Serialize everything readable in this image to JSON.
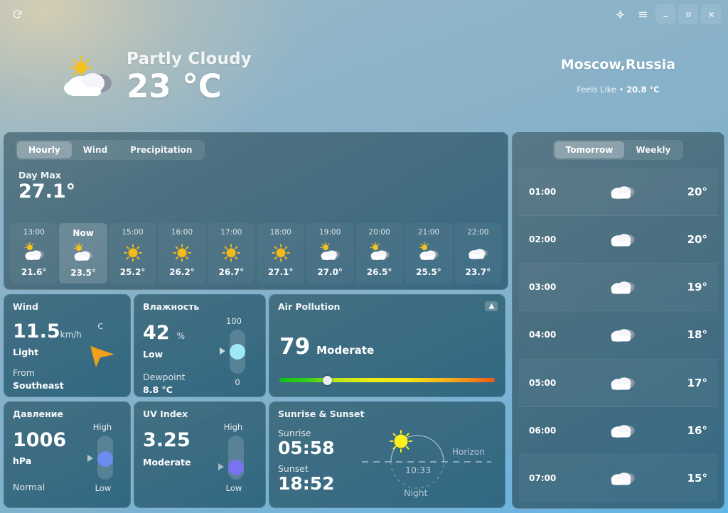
{
  "titlebar": {
    "refresh_icon": "refresh-icon",
    "location_icon": "location-target-icon",
    "menu_icon": "hamburger-menu-icon",
    "minimize_icon": "minimize-icon",
    "maximize_icon": "maximize-icon",
    "close_icon": "close-icon"
  },
  "hero": {
    "condition": "Partly Cloudy",
    "temperature": "23 °C",
    "icon": "partly-cloudy-icon",
    "city": "Moscow,Russia",
    "feels_like_label": "Feels Like •",
    "feels_like_value": "20.8 °C"
  },
  "forecast_tabs": [
    {
      "label": "Hourly",
      "active": true
    },
    {
      "label": "Wind",
      "active": false
    },
    {
      "label": "Precipitation",
      "active": false
    }
  ],
  "day_max": {
    "label": "Day Max",
    "value": "27.1°"
  },
  "hourly": [
    {
      "time": "13:00",
      "temp": "21.6°",
      "icon": "partly-cloudy",
      "now": false
    },
    {
      "time": "Now",
      "temp": "23.5°",
      "icon": "partly-cloudy",
      "now": true
    },
    {
      "time": "15:00",
      "temp": "25.2°",
      "icon": "sunny",
      "now": false
    },
    {
      "time": "16:00",
      "temp": "26.2°",
      "icon": "sunny",
      "now": false
    },
    {
      "time": "17:00",
      "temp": "26.7°",
      "icon": "sunny",
      "now": false
    },
    {
      "time": "18:00",
      "temp": "27.1°",
      "icon": "sunny",
      "now": false
    },
    {
      "time": "19:00",
      "temp": "27.0°",
      "icon": "partly-cloudy",
      "now": false
    },
    {
      "time": "20:00",
      "temp": "26.5°",
      "icon": "partly-cloudy",
      "now": false
    },
    {
      "time": "21:00",
      "temp": "25.5°",
      "icon": "partly-cloudy",
      "now": false
    },
    {
      "time": "22:00",
      "temp": "23.7°",
      "icon": "cloudy",
      "now": false
    }
  ],
  "wind": {
    "title": "Wind",
    "value": "11.5",
    "unit": "km/h",
    "strength": "Light",
    "from_label": "From",
    "direction": "Southeast",
    "compass_letter": "C",
    "arrow_icon": "wind-direction-arrow-icon",
    "arrow_color": "#f0a01a"
  },
  "humidity": {
    "title": "Влажность",
    "value": "42",
    "unit": "%",
    "level": "Low",
    "dewpoint_label": "Dewpoint",
    "dewpoint_value": "8.8 °C",
    "scale_max": "100",
    "scale_min": "0",
    "knob_color": "#9fe8f5",
    "knob_percent": 42
  },
  "air_pollution": {
    "title": "Air Pollution",
    "value": "79",
    "level": "Moderate",
    "icon": "air-quality-chart-icon",
    "marker_percent": 22
  },
  "pressure": {
    "title": "Давление",
    "value": "1006",
    "unit": "hPa",
    "level": "Normal",
    "scale_high": "High",
    "scale_low": "Low",
    "knob_color": "#6b8df0",
    "knob_percent": 52
  },
  "uv_index": {
    "title": "UV Index",
    "value": "3.25",
    "level": "Moderate",
    "scale_high": "High",
    "scale_low": "Low",
    "knob_color": "#7b72f2",
    "knob_percent": 28
  },
  "sun": {
    "title": "Sunrise & Sunset",
    "sunrise_label": "Sunrise",
    "sunrise_time": "05:58",
    "sunset_label": "Sunset",
    "sunset_time": "18:52",
    "horizon_label": "Horizon",
    "night_label": "Night",
    "elapsed": "10:33",
    "sun_icon": "sun-icon"
  },
  "sidebar": {
    "tabs": [
      {
        "label": "Tomorrow",
        "active": true
      },
      {
        "label": "Weekly",
        "active": false
      }
    ],
    "rows": [
      {
        "time": "01:00",
        "icon": "cloudy",
        "temp": "20°"
      },
      {
        "time": "02:00",
        "icon": "cloudy",
        "temp": "20°"
      },
      {
        "time": "03:00",
        "icon": "cloudy",
        "temp": "19°"
      },
      {
        "time": "04:00",
        "icon": "cloudy",
        "temp": "18°"
      },
      {
        "time": "05:00",
        "icon": "cloudy",
        "temp": "17°"
      },
      {
        "time": "06:00",
        "icon": "cloudy",
        "temp": "16°"
      },
      {
        "time": "07:00",
        "icon": "cloudy",
        "temp": "15°"
      }
    ]
  }
}
